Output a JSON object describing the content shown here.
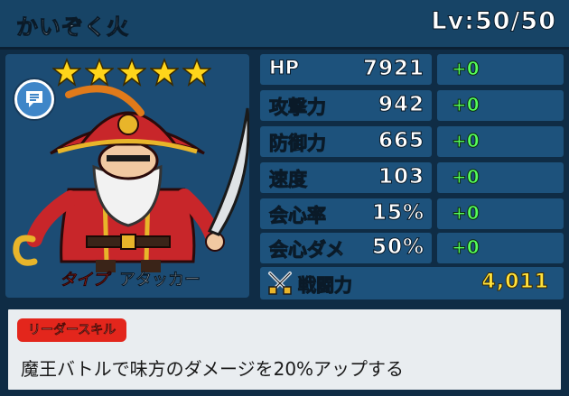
{
  "header": {
    "character_name": "かいぞく火",
    "level": "Lv:50/50"
  },
  "character": {
    "stars": 5,
    "type_label": "タイプ",
    "type_value": "アタッカー",
    "icons": [
      "star-icon",
      "chat-icon"
    ]
  },
  "stats": [
    {
      "label": "HP",
      "value": "7921",
      "bonus": "+0"
    },
    {
      "label": "攻撃力",
      "value": "942",
      "bonus": "+0"
    },
    {
      "label": "防御力",
      "value": "665",
      "bonus": "+0"
    },
    {
      "label": "速度",
      "value": "103",
      "bonus": "+0"
    },
    {
      "label": "会心率",
      "value": "15%",
      "bonus": "+0"
    },
    {
      "label": "会心ダメ",
      "value": "50%",
      "bonus": "+0"
    }
  ],
  "combat_power": {
    "label": "戦闘力",
    "value": "4,011",
    "icon": "crossed-swords-icon"
  },
  "leader_skill": {
    "tag": "リーダースキル",
    "description": "魔王バトルで味方のダメージを20%アップする"
  },
  "colors": {
    "background": "#0f2c45",
    "panel": "#1d527c",
    "bonus_text": "#55ff5a",
    "power_text": "#ffe23c",
    "skill_tag": "#e3261c"
  }
}
